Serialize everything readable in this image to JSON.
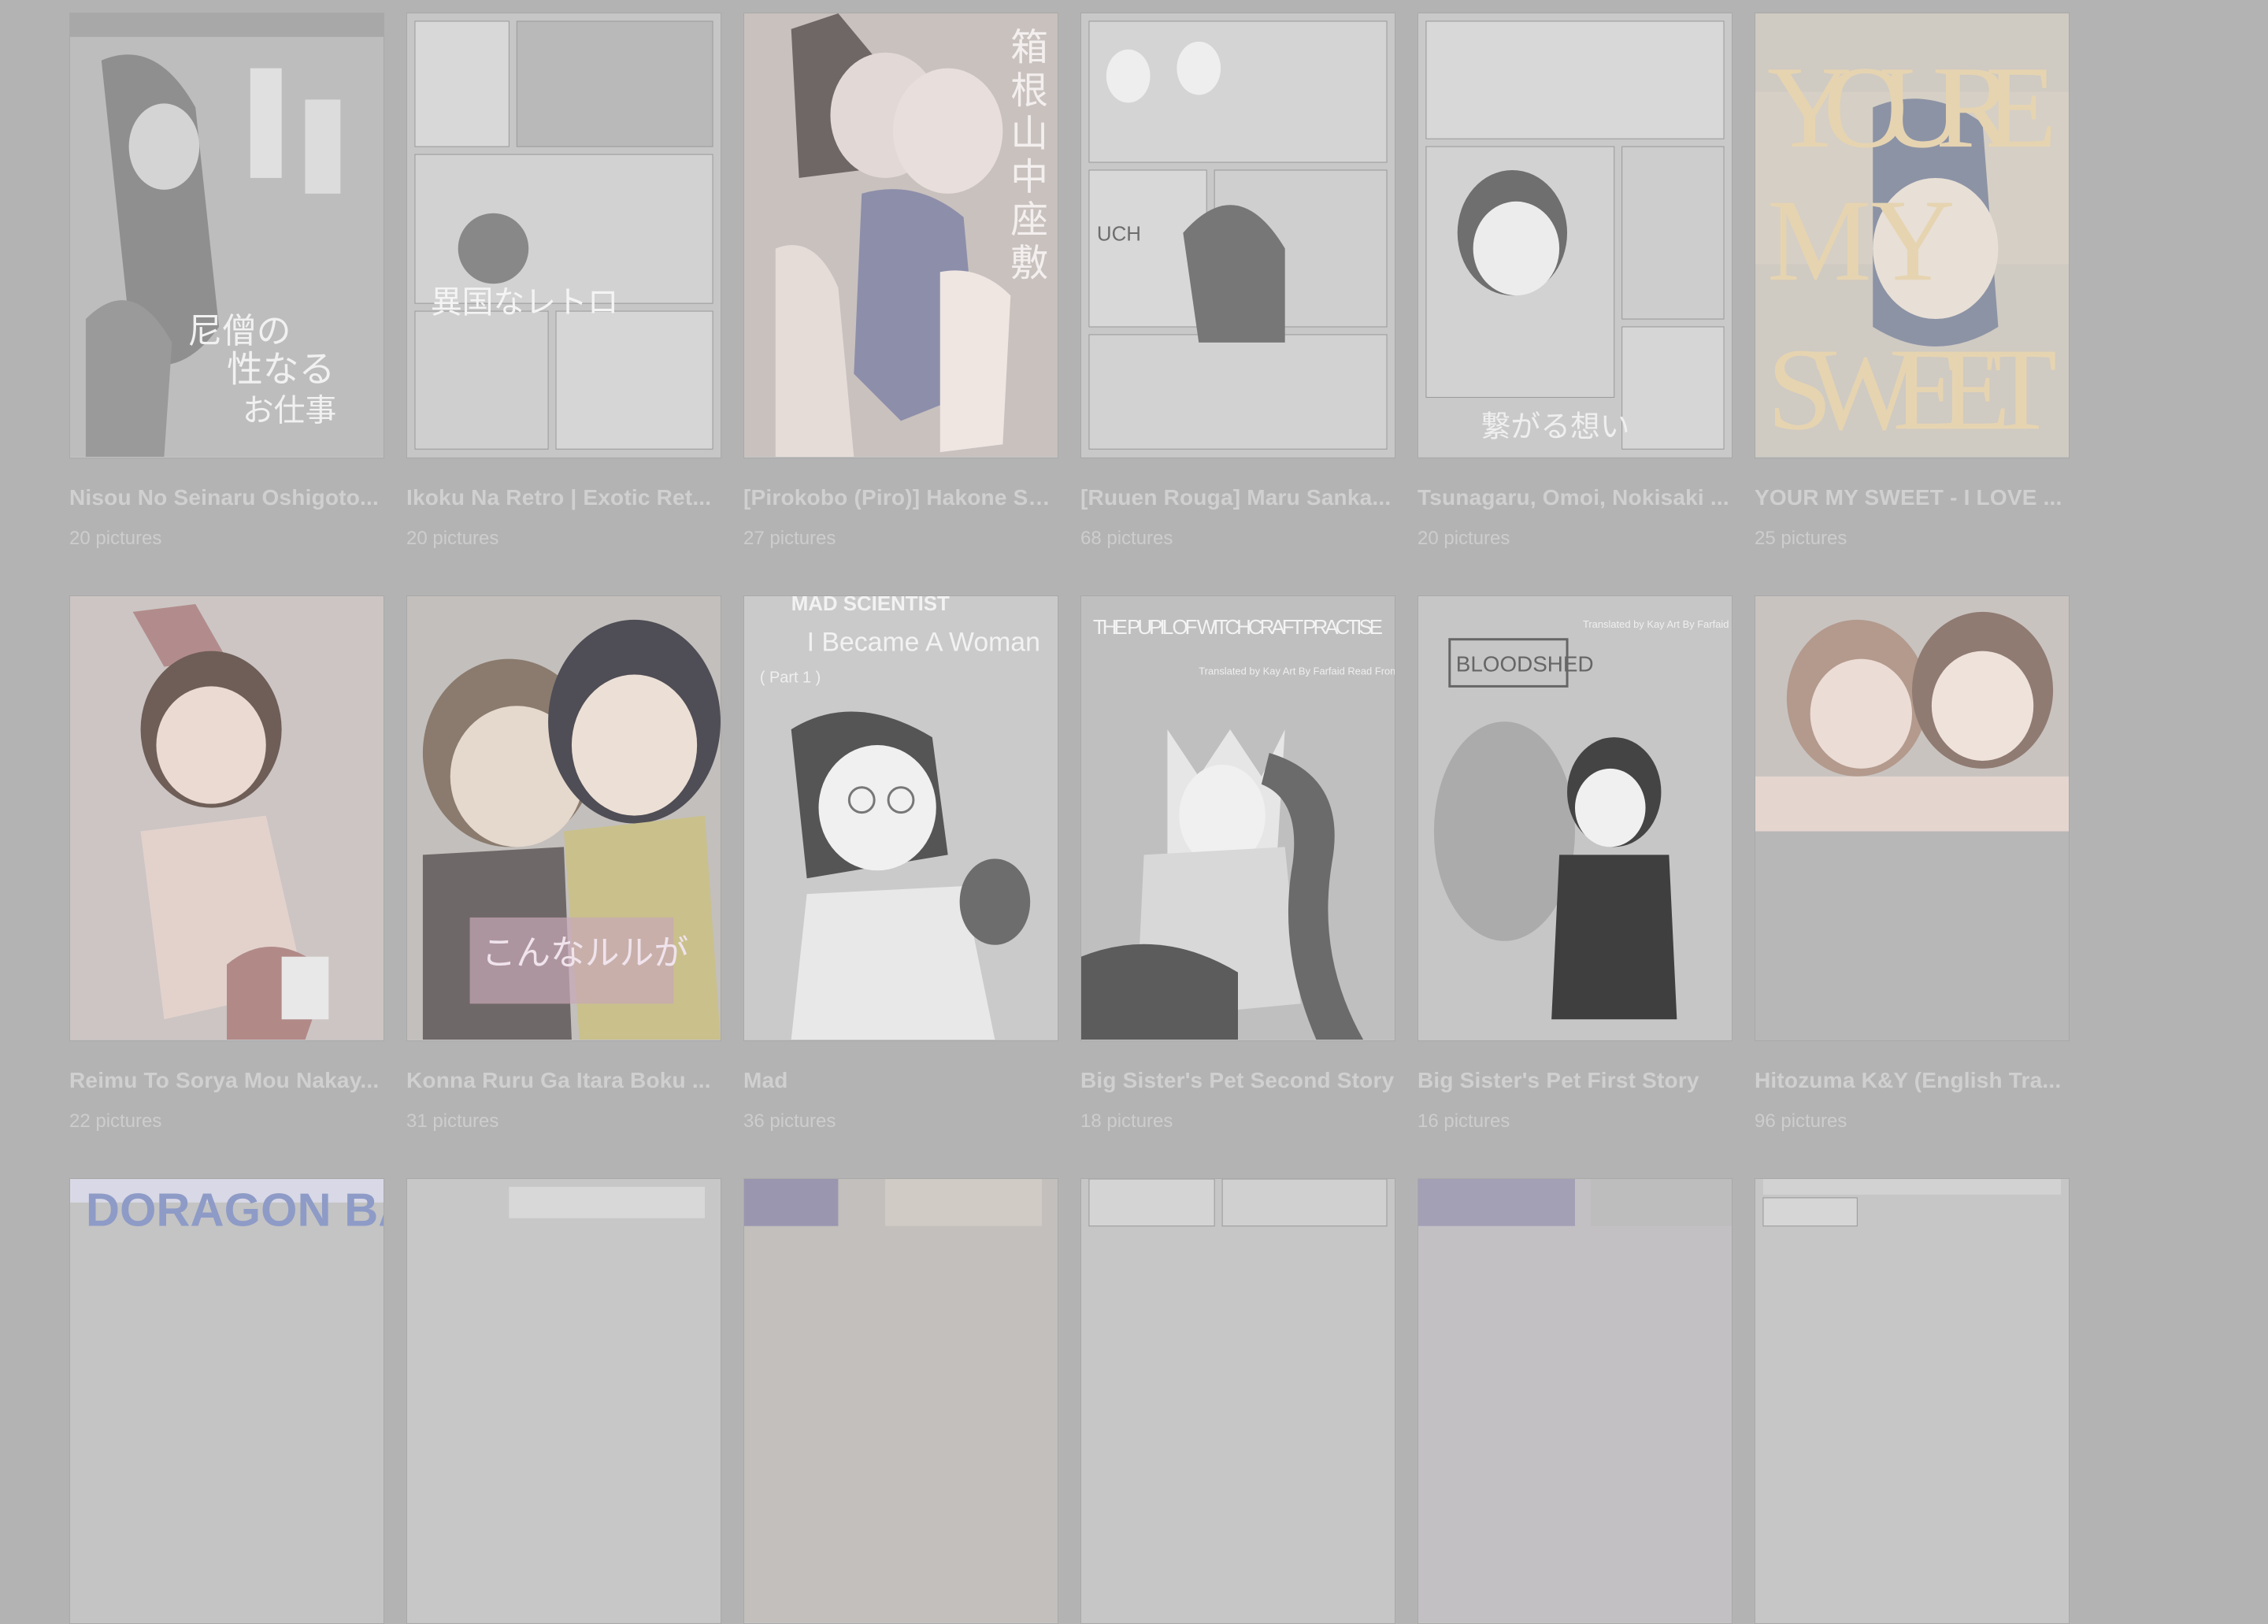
{
  "gallery": {
    "row1": [
      {
        "title": "Nisou No Seinaru Oshigoto...",
        "count": "20 pictures",
        "tone": "#bdbdbd"
      },
      {
        "title": "Ikoku Na Retro | Exotic Ret...",
        "count": "20 pictures",
        "tone": "#c6c6c6"
      },
      {
        "title": "[Pirokobo (Piro)] Hakone Sa...",
        "count": "27 pictures",
        "tone": "#c8c1be"
      },
      {
        "title": "[Ruuen Rouga] Maru Sanka...",
        "count": "68 pictures",
        "tone": "#c8c8c8"
      },
      {
        "title": "Tsunagaru, Omoi, Nokisaki ...",
        "count": "20 pictures",
        "tone": "#c9c9c9"
      },
      {
        "title": "YOUR MY SWEET - I LOVE ...",
        "count": "25 pictures",
        "tone": "#cfcac2"
      }
    ],
    "row2": [
      {
        "title": "Reimu To Sorya Mou Nakay...",
        "count": "22 pictures",
        "tone": "#ccc5c3"
      },
      {
        "title": "Konna Ruru Ga Itara Boku ...",
        "count": "31 pictures",
        "tone": "#c3bfbc"
      },
      {
        "title": "Mad",
        "count": "36 pictures",
        "tone": "#cacaca"
      },
      {
        "title": "Big Sister's Pet Second Story",
        "count": "18 pictures",
        "tone": "#bfbfbf"
      },
      {
        "title": "Big Sister's Pet First Story",
        "count": "16 pictures",
        "tone": "#c6c6c6"
      },
      {
        "title": "Hitozuma K&Y (English Tra...",
        "count": "96 pictures",
        "tone": "#c9c3c0"
      }
    ],
    "row3": [
      {
        "tone": "#c4c4c4"
      },
      {
        "tone": "#c4c4c4"
      },
      {
        "tone": "#c2bfbc"
      },
      {
        "tone": "#c6c6c6"
      },
      {
        "tone": "#c3c0c4"
      },
      {
        "tone": "#c6c6c6"
      }
    ]
  },
  "cover_text": {
    "your_my_sweet": "YOURE MY SWEET",
    "mad_top": "MAD SCIENTIST",
    "mad_sub": "I Became A Woman",
    "mad_part": "( Part 1 )",
    "witch": "THE PUPIL OF WITCHCRAFT PRACTISE",
    "credit": "Translated by Kay Art By Farfaid Read From Right to Left",
    "bloodshed": "BLOODSHED",
    "dragon": "DORAGON BALL",
    "uch": "UCH"
  }
}
